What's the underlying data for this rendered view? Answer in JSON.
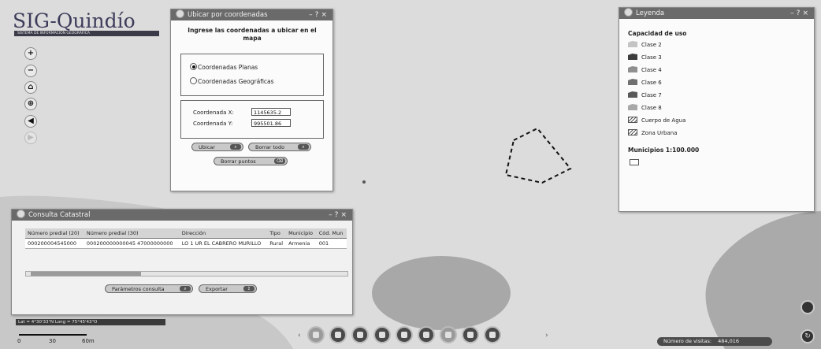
{
  "logo": {
    "title": "SIG-Quindío",
    "subtitle": "SISTEMA DE INFORMACIÓN GEOGRÁFICA"
  },
  "nav": [
    {
      "name": "zoom-in",
      "glyph": "+"
    },
    {
      "name": "zoom-out",
      "glyph": "−"
    },
    {
      "name": "home",
      "glyph": "⌂"
    },
    {
      "name": "full-extent",
      "glyph": "⊕"
    },
    {
      "name": "back",
      "glyph": "◀"
    },
    {
      "name": "forward",
      "glyph": "▶"
    }
  ],
  "ubicar": {
    "title": "Ubicar por coordenadas",
    "heading": "Ingrese las coordenadas a ubicar en el mapa",
    "radio_planas": "Coordenadas Planas",
    "radio_geograficas": "Coordenadas Geográficas",
    "coord_x_label": "Coordenada X:",
    "coord_x_value": "1145635.2",
    "coord_y_label": "Coordenada Y:",
    "coord_y_value": "995501.86",
    "btn_ubicar": "Ubicar",
    "btn_borrar_todo": "Borrar todo",
    "btn_borrar_puntos": "Borrar puntos"
  },
  "leyenda": {
    "title": "Leyenda",
    "section1": "Capacidad de uso",
    "items": [
      {
        "label": "Clase 2",
        "color": "#c4c4c4"
      },
      {
        "label": "Clase 3",
        "color": "#3c3c3c"
      },
      {
        "label": "Clase 4",
        "color": "#8f8f8f"
      },
      {
        "label": "Clase 6",
        "color": "#707070"
      },
      {
        "label": "Clase 7",
        "color": "#595959"
      },
      {
        "label": "Clase 8",
        "color": "#a8a8a8"
      },
      {
        "label": "Cuerpo de Agua",
        "color": "hatch"
      },
      {
        "label": "Zona Urbana",
        "color": "hatch"
      }
    ],
    "section2": "Municipios 1:100.000"
  },
  "catastral": {
    "title": "Consulta Catastral",
    "columns": [
      "Número predial (20)",
      "Número predial (30)",
      "Dirección",
      "Tipo",
      "Municipio",
      "Cód. Mun"
    ],
    "rows": [
      [
        "000200004545000",
        "000200000000045 47000000000",
        "LO 1 UR EL CABRERO MURILLO",
        "Rural",
        "Armenia",
        "001"
      ]
    ],
    "btn_parametros": "Parámetros consulta",
    "btn_exportar": "Exportar"
  },
  "status": {
    "coords": "Lat = 4°30'33\"N Long = 75°45'43\"O",
    "scale_labels": [
      "0",
      "30",
      "60m"
    ],
    "visits_label": "Número de visitas:",
    "visits_value": "484,016"
  },
  "colors": {
    "map_background": "#dcdcdc",
    "map_dark": "#a3a3a3",
    "titlebar": "#6a6a6a"
  }
}
